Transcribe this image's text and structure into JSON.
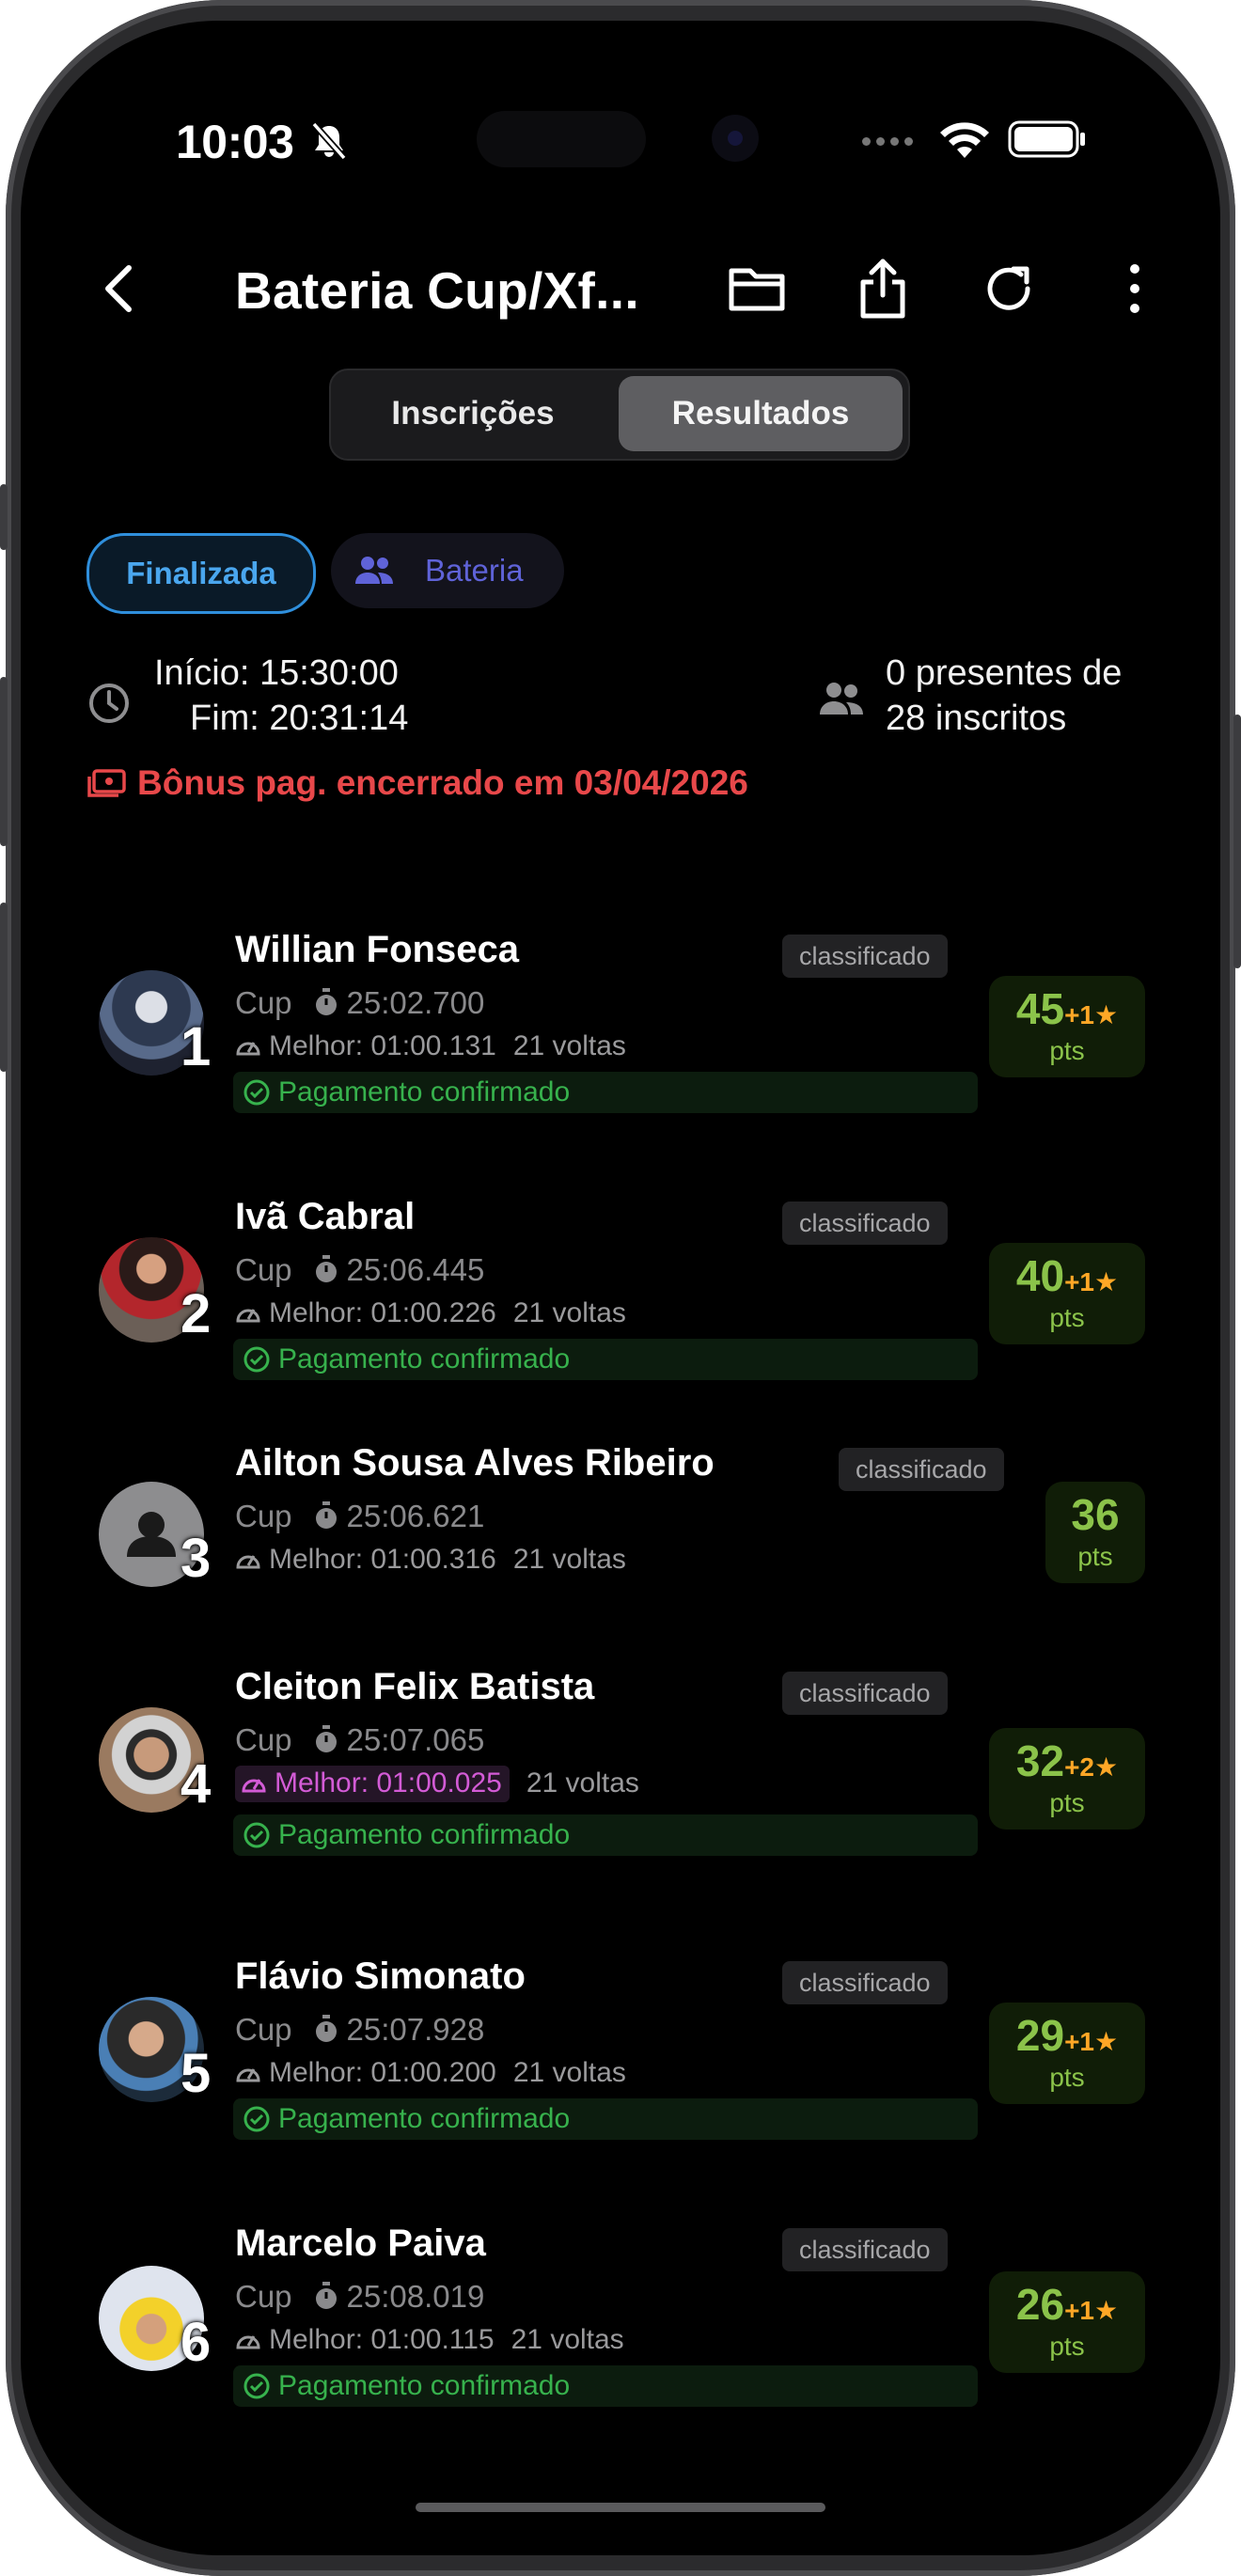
{
  "status_bar": {
    "time": "10:03"
  },
  "header": {
    "title": "Bateria Cup/Xf..."
  },
  "tabs": [
    {
      "label": "Inscrições"
    },
    {
      "label": "Resultados"
    }
  ],
  "chips": {
    "state": "Finalizada",
    "type": "Bateria"
  },
  "session": {
    "start": "Início: 15:30:00",
    "end": "Fim: 20:31:14",
    "presence_line1": "0 presentes de",
    "presence_line2": "28 inscritos",
    "bonus_notice": "Bônus pag. encerrado em 03/04/2026"
  },
  "results": [
    {
      "pos": "1",
      "name": "Willian Fonseca",
      "status": "classificado",
      "category": "Cup",
      "total": "25:02.700",
      "best": "Melhor: 01:00.131",
      "laps": "21 voltas",
      "payment": "Pagamento confirmado",
      "points": "45",
      "bonus": "+1★"
    },
    {
      "pos": "2",
      "name": "Ivã Cabral",
      "status": "classificado",
      "category": "Cup",
      "total": "25:06.445",
      "best": "Melhor: 01:00.226",
      "laps": "21 voltas",
      "payment": "Pagamento confirmado",
      "points": "40",
      "bonus": "+1★"
    },
    {
      "pos": "3",
      "name": "Ailton Sousa Alves Ribeiro",
      "status": "classificado",
      "category": "Cup",
      "total": "25:06.621",
      "best": "Melhor: 01:00.316",
      "laps": "21 voltas",
      "payment": "",
      "points": "36",
      "bonus": ""
    },
    {
      "pos": "4",
      "name": "Cleiton Felix Batista",
      "status": "classificado",
      "category": "Cup",
      "total": "25:07.065",
      "best": "Melhor: 01:00.025",
      "laps": "21 voltas",
      "payment": "Pagamento confirmado",
      "points": "32",
      "bonus": "+2★"
    },
    {
      "pos": "5",
      "name": "Flávio Simonato",
      "status": "classificado",
      "category": "Cup",
      "total": "25:07.928",
      "best": "Melhor: 01:00.200",
      "laps": "21 voltas",
      "payment": "Pagamento confirmado",
      "points": "29",
      "bonus": "+1★"
    },
    {
      "pos": "6",
      "name": "Marcelo Paiva",
      "status": "classificado",
      "category": "Cup",
      "total": "25:08.019",
      "best": "Melhor: 01:00.115",
      "laps": "21 voltas",
      "payment": "Pagamento confirmado",
      "points": "26",
      "bonus": "+1★"
    }
  ],
  "points_unit": "pts",
  "colors": {
    "accent_green": "#8bc34a",
    "bonus_orange": "#ffa726",
    "warning_red": "#e8484a",
    "fastest_lap": "#d35bd6",
    "selected_chip": "#2f8fdc"
  }
}
